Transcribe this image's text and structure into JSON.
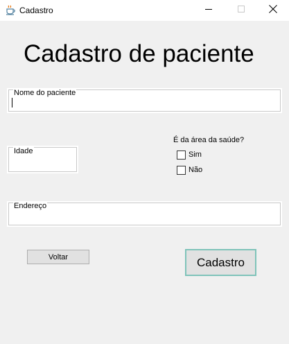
{
  "window": {
    "title": "Cadastro",
    "icon": "java-cup-icon",
    "controls": [
      "minimize-icon",
      "maximize-icon",
      "close-icon"
    ]
  },
  "form": {
    "heading": "Cadastro de paciente",
    "nome_label": "Nome do paciente",
    "nome_value": "",
    "idade_label": "Idade",
    "idade_value": "",
    "area_saude_question": "É da área da saúde?",
    "option_sim": "Sim",
    "option_nao": "Não",
    "endereco_label": "Endereço",
    "endereco_value": ""
  },
  "buttons": {
    "voltar": "Voltar",
    "cadastro": "Cadastro"
  },
  "colors": {
    "window_bg": "#f0f0f0",
    "titlebar_bg": "#ffffff",
    "cadastro_focus_border": "#7ec3b9"
  }
}
